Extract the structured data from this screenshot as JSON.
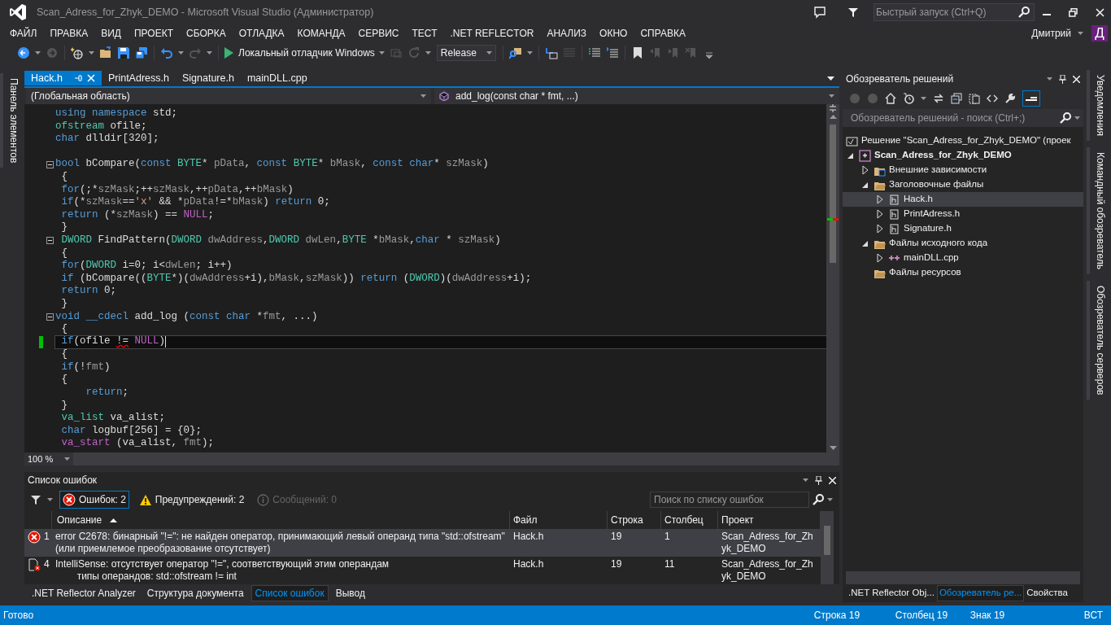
{
  "window": {
    "title": "Scan_Adress_for_Zhyk_DEMO - Microsoft Visual Studio (Администратор)"
  },
  "quick_launch": {
    "placeholder": "Быстрый запуск (Ctrl+Q)"
  },
  "menu": [
    "ФАЙЛ",
    "ПРАВКА",
    "ВИД",
    "ПРОЕКТ",
    "СБОРКА",
    "ОТЛАДКА",
    "КОМАНДА",
    "СЕРВИС",
    "ТЕСТ",
    ".NET REFLECTOR",
    "АНАЛИЗ",
    "ОКНО",
    "СПРАВКА"
  ],
  "user": {
    "name": "Дмитрий",
    "avatar": "Д"
  },
  "toolbar": {
    "debugger": "Локальный отладчик Windows",
    "configuration": "Release"
  },
  "left_strip": [
    "Панель элементов"
  ],
  "document_tabs": [
    {
      "label": "Hack.h",
      "selected": true
    },
    {
      "label": "PrintAdress.h",
      "selected": false
    },
    {
      "label": "Signature.h",
      "selected": false
    },
    {
      "label": "mainDLL.cpp",
      "selected": false
    }
  ],
  "navigation": {
    "scope": "(Глобальная область)",
    "member": "add_log(const char * fmt, ...)"
  },
  "editor": {
    "zoom": "100 %",
    "lines": [
      {
        "tokens": [
          {
            "kind": "kw",
            "text": "using"
          },
          {
            "kind": "kw",
            "text": " namespace"
          },
          {
            "text": " std;"
          }
        ]
      },
      {
        "tokens": [
          {
            "kind": "type",
            "text": "ofstream"
          },
          {
            "text": " ofile;"
          }
        ]
      },
      {
        "tokens": [
          {
            "kind": "kw",
            "text": "char"
          },
          {
            "text": " dlldir[320];"
          }
        ]
      },
      {
        "kind": "blank"
      },
      {
        "fold": true,
        "tokens": [
          {
            "kind": "kw",
            "text": "bool"
          },
          {
            "text": " bCompare("
          },
          {
            "kind": "kw",
            "text": "const"
          },
          {
            "kind": "type",
            "text": " BYTE"
          },
          {
            "text": "* "
          },
          {
            "kind": "param",
            "text": "pData"
          },
          {
            "text": ", "
          },
          {
            "kind": "kw",
            "text": "const"
          },
          {
            "kind": "type",
            "text": " BYTE"
          },
          {
            "text": "* "
          },
          {
            "kind": "param",
            "text": "bMask"
          },
          {
            "text": ", "
          },
          {
            "kind": "kw",
            "text": "const"
          },
          {
            "kind": "kw",
            "text": " char"
          },
          {
            "text": "* "
          },
          {
            "kind": "param",
            "text": "szMask"
          },
          {
            "text": ")"
          }
        ]
      },
      {
        "tokens": [
          {
            "text": " {"
          }
        ]
      },
      {
        "tokens": [
          {
            "kind": "kw",
            "text": " for"
          },
          {
            "text": "(;*"
          },
          {
            "kind": "param",
            "text": "szMask"
          },
          {
            "text": ";++"
          },
          {
            "kind": "param",
            "text": "szMask"
          },
          {
            "text": ",++"
          },
          {
            "kind": "param",
            "text": "pData"
          },
          {
            "text": ",++"
          },
          {
            "kind": "param",
            "text": "bMask"
          },
          {
            "text": ")"
          }
        ]
      },
      {
        "tokens": [
          {
            "kind": "kw",
            "text": " if"
          },
          {
            "text": "(*"
          },
          {
            "kind": "param",
            "text": "szMask"
          },
          {
            "text": "=="
          },
          {
            "kind": "str",
            "text": "'x'"
          },
          {
            "text": " && *"
          },
          {
            "kind": "param",
            "text": "pData"
          },
          {
            "text": "!=*"
          },
          {
            "kind": "param",
            "text": "bMask"
          },
          {
            "text": ") "
          },
          {
            "kind": "kw",
            "text": "return"
          },
          {
            "text": " 0;"
          }
        ]
      },
      {
        "tokens": [
          {
            "kind": "kw",
            "text": " return"
          },
          {
            "text": " (*"
          },
          {
            "kind": "param",
            "text": "szMask"
          },
          {
            "text": ") == "
          },
          {
            "kind": "macro",
            "text": "NULL"
          },
          {
            "text": ";"
          }
        ]
      },
      {
        "tokens": [
          {
            "text": " }"
          }
        ]
      },
      {
        "fold": true,
        "tokens": [
          {
            "kind": "type",
            "text": " DWORD"
          },
          {
            "text": " FindPattern("
          },
          {
            "kind": "type",
            "text": "DWORD"
          },
          {
            "kind": "param",
            "text": " dwAddress"
          },
          {
            "text": ","
          },
          {
            "kind": "type",
            "text": "DWORD"
          },
          {
            "kind": "param",
            "text": " dwLen"
          },
          {
            "text": ","
          },
          {
            "kind": "type",
            "text": "BYTE"
          },
          {
            "text": " *"
          },
          {
            "kind": "param",
            "text": "bMask"
          },
          {
            "text": ","
          },
          {
            "kind": "kw",
            "text": "char"
          },
          {
            "text": " * "
          },
          {
            "kind": "param",
            "text": "szMask"
          },
          {
            "text": ")"
          }
        ]
      },
      {
        "tokens": [
          {
            "text": " {"
          }
        ]
      },
      {
        "tokens": [
          {
            "kind": "kw",
            "text": " for"
          },
          {
            "text": "("
          },
          {
            "kind": "type",
            "text": "DWORD"
          },
          {
            "text": " i=0; i<"
          },
          {
            "kind": "param",
            "text": "dwLen"
          },
          {
            "text": "; i++)"
          }
        ]
      },
      {
        "tokens": [
          {
            "kind": "kw",
            "text": " if"
          },
          {
            "text": " (bCompare(("
          },
          {
            "kind": "type",
            "text": "BYTE"
          },
          {
            "text": "*)("
          },
          {
            "kind": "param",
            "text": "dwAddress"
          },
          {
            "text": "+i),"
          },
          {
            "kind": "param",
            "text": "bMask"
          },
          {
            "text": ","
          },
          {
            "kind": "param",
            "text": "szMask"
          },
          {
            "text": ")) "
          },
          {
            "kind": "kw",
            "text": "return"
          },
          {
            "text": " ("
          },
          {
            "kind": "type",
            "text": "DWORD"
          },
          {
            "text": ")("
          },
          {
            "kind": "param",
            "text": "dwAddress"
          },
          {
            "text": "+i);"
          }
        ]
      },
      {
        "tokens": [
          {
            "kind": "kw",
            "text": " return"
          },
          {
            "text": " 0;"
          }
        ]
      },
      {
        "tokens": [
          {
            "text": " }"
          }
        ]
      },
      {
        "fold": true,
        "tokens": [
          {
            "kind": "kw",
            "text": "void"
          },
          {
            "kind": "kw",
            "text": " __cdecl"
          },
          {
            "text": " add_log ("
          },
          {
            "kind": "kw",
            "text": "const"
          },
          {
            "kind": "kw",
            "text": " char"
          },
          {
            "text": " *"
          },
          {
            "kind": "param",
            "text": "fmt"
          },
          {
            "text": ", ...)"
          }
        ]
      },
      {
        "tokens": [
          {
            "text": " {"
          }
        ]
      },
      {
        "current": true,
        "changed": true,
        "tokens": [
          {
            "kind": "kw",
            "text": " if"
          },
          {
            "text": "(ofile "
          },
          {
            "kind": "error",
            "text": "!="
          },
          {
            "kind": "macro",
            "text": " NULL"
          },
          {
            "text": ")"
          }
        ]
      },
      {
        "tokens": [
          {
            "text": " {"
          }
        ]
      },
      {
        "tokens": [
          {
            "kind": "kw",
            "text": " if"
          },
          {
            "text": "(!"
          },
          {
            "kind": "param",
            "text": "fmt"
          },
          {
            "text": ")"
          }
        ]
      },
      {
        "tokens": [
          {
            "text": " {"
          }
        ]
      },
      {
        "tokens": [
          {
            "kind": "kw",
            "text": "     return"
          },
          {
            "text": ";"
          }
        ]
      },
      {
        "tokens": [
          {
            "text": " }"
          }
        ]
      },
      {
        "tokens": [
          {
            "kind": "type",
            "text": " va_list"
          },
          {
            "text": " va_alist;"
          }
        ]
      },
      {
        "tokens": [
          {
            "kind": "kw",
            "text": " char"
          },
          {
            "text": " logbuf[256] = {0};"
          }
        ]
      },
      {
        "tokens": [
          {
            "kind": "macro",
            "text": " va_start"
          },
          {
            "text": " (va_alist, "
          },
          {
            "kind": "param",
            "text": "fmt"
          },
          {
            "text": ");"
          }
        ]
      }
    ]
  },
  "error_list": {
    "title": "Список ошибок",
    "filters": [
      {
        "kind": "error",
        "label": "Ошибок: 2",
        "selected": true,
        "disabled": false
      },
      {
        "kind": "warning",
        "label": "Предупреждений: 2",
        "selected": false,
        "disabled": false
      },
      {
        "kind": "info",
        "label": "Сообщений: 0",
        "selected": false,
        "disabled": true
      }
    ],
    "search": {
      "placeholder": "Поиск по списку ошибок"
    },
    "columns": [
      {
        "label": "Описание",
        "sorted": true
      },
      {
        "label": "Файл",
        "sorted": false
      },
      {
        "label": "Строка",
        "sorted": false
      },
      {
        "label": "Столбец",
        "sorted": false
      },
      {
        "label": "Проект",
        "sorted": false
      }
    ],
    "rows": [
      {
        "kind": "error",
        "number": "1",
        "description": "error C2678: бинарный \"!=\": не найден оператор, принимающий левый операнд типа \"std::ofstream\" (или приемлемое преобразование отсутствует)",
        "file": "Hack.h",
        "line": "19",
        "column": "1",
        "project": "Scan_Adress_for_Zhyk_DEMO",
        "selected": true
      },
      {
        "kind": "intellisense",
        "number": "4",
        "description": "IntelliSense: отсутствует оператор \"!=\", соответствующий этим операндам\n        типы операндов: std::ofstream != int",
        "file": "Hack.h",
        "line": "19",
        "column": "11",
        "project": "Scan_Adress_for_Zhyk_DEMO",
        "selected": false
      }
    ]
  },
  "bottom_tabs_left": [
    {
      "label": ".NET Reflector Analyzer",
      "selected": false
    },
    {
      "label": "Структура документа",
      "selected": false
    },
    {
      "label": "Список ошибок",
      "selected": true
    },
    {
      "label": "Вывод",
      "selected": false
    }
  ],
  "solution_explorer": {
    "title": "Обозреватель решений",
    "search": {
      "placeholder": "Обозреватель решений - поиск (Ctrl+;)"
    },
    "tree": [
      {
        "label": "Решение \"Scan_Adress_for_Zhyk_DEMO\"  (проек",
        "kind": "solution",
        "selected": false,
        "children": [
          {
            "label": "Scan_Adress_for_Zhyk_DEMO",
            "kind": "project",
            "expanded": true,
            "selected": false,
            "children": [
              {
                "label": "Внешние зависимости",
                "kind": "deps",
                "expanded": false,
                "selected": false
              },
              {
                "label": "Заголовочные файлы",
                "kind": "folder",
                "expanded": true,
                "selected": false,
                "children": [
                  {
                    "label": "Hack.h",
                    "kind": "header",
                    "expanded": false,
                    "selected": true
                  },
                  {
                    "label": "PrintAdress.h",
                    "kind": "header",
                    "expanded": false,
                    "selected": false
                  },
                  {
                    "label": "Signature.h",
                    "kind": "header",
                    "expanded": false,
                    "selected": false
                  }
                ]
              },
              {
                "label": "Файлы исходного кода",
                "kind": "folder",
                "expanded": true,
                "selected": false,
                "children": [
                  {
                    "label": "mainDLL.cpp",
                    "kind": "cpp",
                    "expanded": false,
                    "selected": false
                  }
                ]
              },
              {
                "label": "Файлы ресурсов",
                "kind": "folder",
                "selected": false
              }
            ]
          }
        ]
      }
    ]
  },
  "right_strip": [
    "Уведомления",
    "Командный обозреватель",
    "Обозреватель серверов"
  ],
  "bottom_tabs_right": [
    {
      "label": ".NET Reflector Obj...",
      "selected": false
    },
    {
      "label": "Обозреватель ре...",
      "selected": true
    },
    {
      "label": "Свойства",
      "selected": false
    }
  ],
  "status_bar": {
    "message": "Готово",
    "line": "Строка 19",
    "column": "Столбец 19",
    "char": "Знак 19",
    "mode": "ВСТ"
  }
}
